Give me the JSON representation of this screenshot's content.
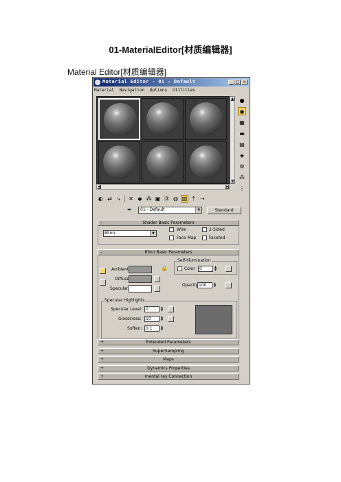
{
  "doc": {
    "title": "01-MaterialEditor[材质编辑器]",
    "subtitle": "Material Editor[材质编辑器]"
  },
  "window": {
    "title": "Material Editor - 01 - Default",
    "min": "_",
    "max": "□",
    "close": "×"
  },
  "menu": [
    "Material",
    "Navigation",
    "Options",
    "Utilities"
  ],
  "material": {
    "name": "01 - Default",
    "type_button": "Standard"
  },
  "shader_basic": {
    "title": "Shader Basic Parameters",
    "shader": "Blinn",
    "wire": "Wire",
    "two_sided": "2-Sided",
    "face_map": "Face Map",
    "faceted": "Faceted"
  },
  "blinn_basic": {
    "title": "Blinn Basic Parameters",
    "self_illum_title": "Self-Illumination",
    "color_label": "Color",
    "color_value": "0",
    "ambient": "Ambient:",
    "diffuse": "Diffuse:",
    "specular": "Specular:",
    "opacity_label": "Opacity:",
    "opacity_value": "100",
    "highlights_title": "Specular Highlights",
    "spec_level_label": "Specular Level:",
    "spec_level_value": "0",
    "gloss_label": "Glossiness:",
    "gloss_value": "10",
    "soften_label": "Soften:",
    "soften_value": "0.1"
  },
  "collapsed_rollouts": [
    "Extended Parameters",
    "SuperSampling",
    "Maps",
    "Dynamics Properties",
    "mental ray Connection"
  ],
  "symbols": {
    "minus": "-",
    "plus": "+"
  },
  "colors": {
    "title_start": "#0a246a",
    "title_end": "#a6caf0",
    "window_bg": "#d4d0c8",
    "ambient": "#969696",
    "diffuse": "#969696",
    "specular": "#ffffff",
    "active_tool": "#f4d36b"
  }
}
